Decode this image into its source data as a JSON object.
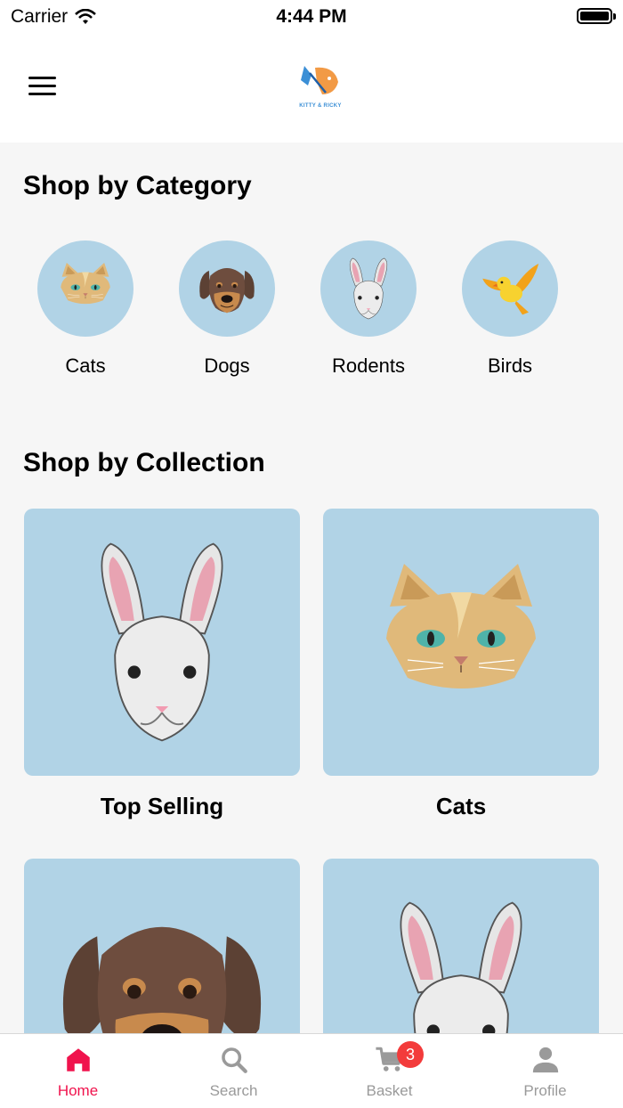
{
  "status_bar": {
    "carrier": "Carrier",
    "time": "4:44 PM"
  },
  "header": {
    "logo_text": "KITTY & RICKY"
  },
  "categories_section": {
    "title": "Shop by Category",
    "items": [
      {
        "label": "Cats",
        "icon": "cat-icon"
      },
      {
        "label": "Dogs",
        "icon": "dog-icon"
      },
      {
        "label": "Rodents",
        "icon": "rabbit-icon"
      },
      {
        "label": "Birds",
        "icon": "bird-icon"
      }
    ]
  },
  "collections_section": {
    "title": "Shop by Collection",
    "items": [
      {
        "label": "Top Selling",
        "icon": "rabbit-icon"
      },
      {
        "label": "Cats",
        "icon": "cat-icon"
      },
      {
        "label": "",
        "icon": "dog-icon"
      },
      {
        "label": "",
        "icon": "rabbit-icon"
      }
    ]
  },
  "tabbar": {
    "tabs": [
      {
        "label": "Home",
        "icon": "home-icon",
        "active": true
      },
      {
        "label": "Search",
        "icon": "search-icon"
      },
      {
        "label": "Basket",
        "icon": "cart-icon",
        "badge": "3"
      },
      {
        "label": "Profile",
        "icon": "person-icon"
      }
    ]
  },
  "colors": {
    "accent": "#f0134d",
    "card_bg": "#b1d3e6",
    "badge": "#f33b3b"
  }
}
